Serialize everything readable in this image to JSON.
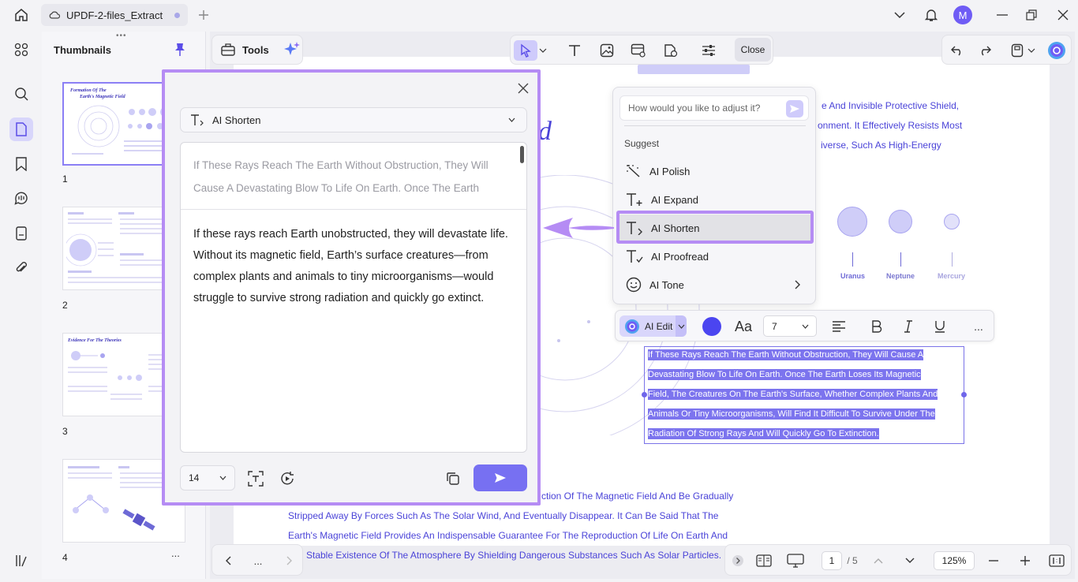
{
  "titlebar": {
    "tab_title": "UPDF-2-files_Extract",
    "avatar_letter": "M"
  },
  "thumbnails": {
    "title": "Thumbnails",
    "pages": [
      "1",
      "2",
      "3",
      "4"
    ],
    "page1_title_a": "Formation Of The",
    "page1_title_b": "Earth's Magnetic Field",
    "page3_title": "Evidence For The Theories",
    "more": "..."
  },
  "tools": {
    "label": "Tools"
  },
  "edit_toolbar": {
    "close_label": "Close"
  },
  "page": {
    "title_fragment": "d",
    "top_lines": [
      "e And Invisible Protective Shield,",
      "onment. It Effectively Resists Most",
      "iverse, Such As High-Energy"
    ],
    "bottom_lines": [
      "ction Of The Magnetic Field And Be Gradually",
      "Stripped Away By Forces Such As The Solar Wind, And Eventually Disappear. It Can Be Said That The",
      "Earth's Magnetic Field Provides An Indispensable Guarantee For The Reproduction Of Life On Earth And",
      "Stable Existence Of The Atmosphere By Shielding Dangerous Substances Such As Solar Particles."
    ],
    "planets": [
      "Uranus",
      "Neptune",
      "Mercury"
    ],
    "selected_lines": [
      "If These Rays Reach The Earth Without Obstruction, They Will Cause A",
      "Devastating Blow To Life On Earth. Once The Earth Loses Its Magnetic",
      "Field, The Creatures On The Earth's Surface, Whether Complex Plants And",
      "Animals Or Tiny Microorganisms, Will Find It Difficult To Survive Under The",
      "Radiation Of Strong Rays And Will Quickly Go To Extinction."
    ]
  },
  "format_bar": {
    "ai_edit_label": "AI Edit",
    "font_label": "Aa",
    "font_size": "7",
    "color": "#4b45f0",
    "more": "..."
  },
  "ai_menu": {
    "input_placeholder": "How would you like to adjust it?",
    "suggest_label": "Suggest",
    "items": [
      "AI Polish",
      "AI Expand",
      "AI Shorten",
      "AI Proofread",
      "AI Tone"
    ]
  },
  "ai_panel": {
    "mode": "AI Shorten",
    "source_text": "If These Rays Reach The Earth Without Obstruction, They Will Cause A Devastating Blow To Life On Earth. Once The Earth",
    "result_text": "If these rays reach Earth unobstructed, they will devastate life. Without its magnetic field, Earth’s surface creatures—from complex plants and animals to tiny microorganisms—would struggle to survive strong radiation and quickly go extinct.",
    "font_size": "14"
  },
  "bottom": {
    "more": "...",
    "current_page": "1",
    "total_pages": "/ 5",
    "zoom": "125%"
  },
  "colors": {
    "accent": "#6f5cf5",
    "highlight_frame": "#b58cf4",
    "page_text": "#4a43d8"
  }
}
